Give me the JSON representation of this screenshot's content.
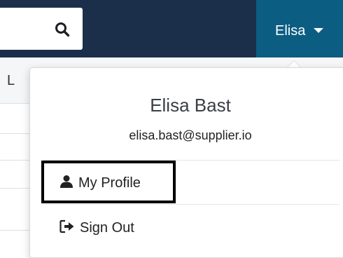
{
  "header": {
    "search": {
      "icon": "search-icon"
    },
    "user_menu": {
      "label": "Elisa",
      "icon": "caret-down-icon"
    }
  },
  "background": {
    "partial_text": "L"
  },
  "dropdown": {
    "user_name": "Elisa Bast",
    "user_email": "elisa.bast@supplier.io",
    "items": [
      {
        "label": "My Profile",
        "icon": "user-icon"
      },
      {
        "label": "Sign Out",
        "icon": "sign-out-icon"
      }
    ]
  },
  "colors": {
    "navbar": "#1b2f4b",
    "user_menu_bg": "#0c5d82",
    "highlight_border": "#000000"
  }
}
